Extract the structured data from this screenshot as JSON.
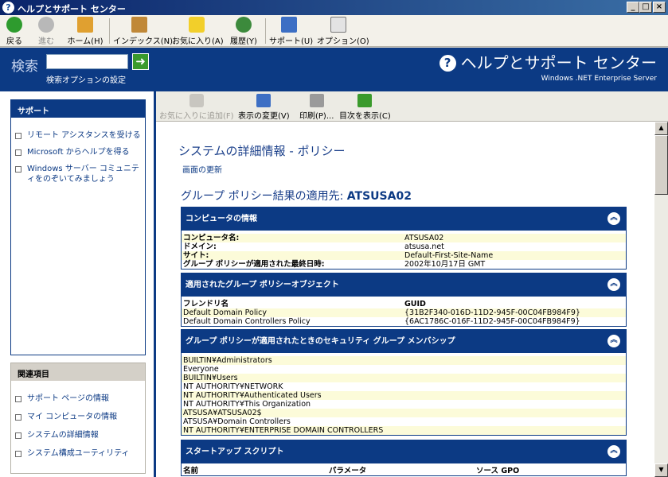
{
  "window": {
    "title": "ヘルプとサポート センター",
    "controls": [
      "_",
      "□",
      "×"
    ]
  },
  "toolbar": {
    "buttons": [
      {
        "label": "戻る",
        "icon": "back-arrow-icon"
      },
      {
        "label": "進む",
        "icon": "forward-arrow-icon"
      },
      {
        "label": "ホーム(H)",
        "icon": "home-icon"
      },
      {
        "label": "インデックス(N)",
        "icon": "index-book-icon"
      },
      {
        "label": "お気に入り(A)",
        "icon": "favorites-star-icon"
      },
      {
        "label": "履歴(Y)",
        "icon": "history-icon"
      },
      {
        "label": "サポート(U)",
        "icon": "support-icon"
      },
      {
        "label": "オプション(O)",
        "icon": "options-icon"
      }
    ]
  },
  "header": {
    "search_label": "検索",
    "search_value": "",
    "go_symbol": "➜",
    "search_options": "検索オプションの設定",
    "product_title": "ヘルプとサポート センター",
    "edition": "Windows .NET Enterprise Server"
  },
  "sidebar": {
    "support_heading": "サポート",
    "support_items": [
      "リモート アシスタンスを受ける",
      "Microsoft からヘルプを得る",
      "Windows サーバー コミュニティをのぞいてみましょう"
    ],
    "related_heading": "関連項目",
    "related_items": [
      "サポート ページの情報",
      "マイ コンピュータの情報",
      "システムの詳細情報",
      "システム構成ユーティリティ"
    ]
  },
  "content_toolbar": {
    "add_favorites": "お気に入りに追加(F)",
    "change_view": "表示の変更(V)",
    "print": "印刷(P)...",
    "show_index": "目次を表示(C)"
  },
  "page": {
    "title": "システムの詳細情報 - ポリシー",
    "refresh": "画面の更新",
    "gp_prefix": "グループ ポリシー結果の適用先: ",
    "gp_target": "ATSUSA02"
  },
  "sections": {
    "computer": {
      "heading": "コンピュータの情報",
      "rows": [
        [
          "コンピュータ名:",
          "ATSUSA02"
        ],
        [
          "ドメイン:",
          "atsusa.net"
        ],
        [
          "サイト:",
          "Default-First-Site-Name"
        ],
        [
          "グループ ポリシーが適用された最終日時:",
          "2002年10月17日 GMT"
        ]
      ]
    },
    "gpo": {
      "heading": "適用されたグループ ポリシーオブジェクト",
      "columns": [
        "フレンドリ名",
        "GUID"
      ],
      "rows": [
        [
          "Default Domain Policy",
          "{31B2F340-016D-11D2-945F-00C04FB984F9}"
        ],
        [
          "Default Domain Controllers Policy",
          "{6AC1786C-016F-11D2-945F-00C04FB984F9}"
        ]
      ]
    },
    "security": {
      "heading": "グループ ポリシーが適用されたときのセキュリティ グループ メンバシップ",
      "rows": [
        "BUILTIN¥Administrators",
        "Everyone",
        "BUILTIN¥Users",
        "NT AUTHORITY¥NETWORK",
        "NT AUTHORITY¥Authenticated Users",
        "NT AUTHORITY¥This Organization",
        "ATSUSA¥ATSUSA02$",
        "ATSUSA¥Domain Controllers",
        "NT AUTHORITY¥ENTERPRISE DOMAIN CONTROLLERS"
      ]
    },
    "startup": {
      "heading": "スタートアップ スクリプト",
      "columns": [
        "名前",
        "パラメータ",
        "ソース GPO"
      ]
    }
  },
  "colors": {
    "brand_blue": "#0c3a84",
    "row_highlight": "#fcfbd9"
  }
}
